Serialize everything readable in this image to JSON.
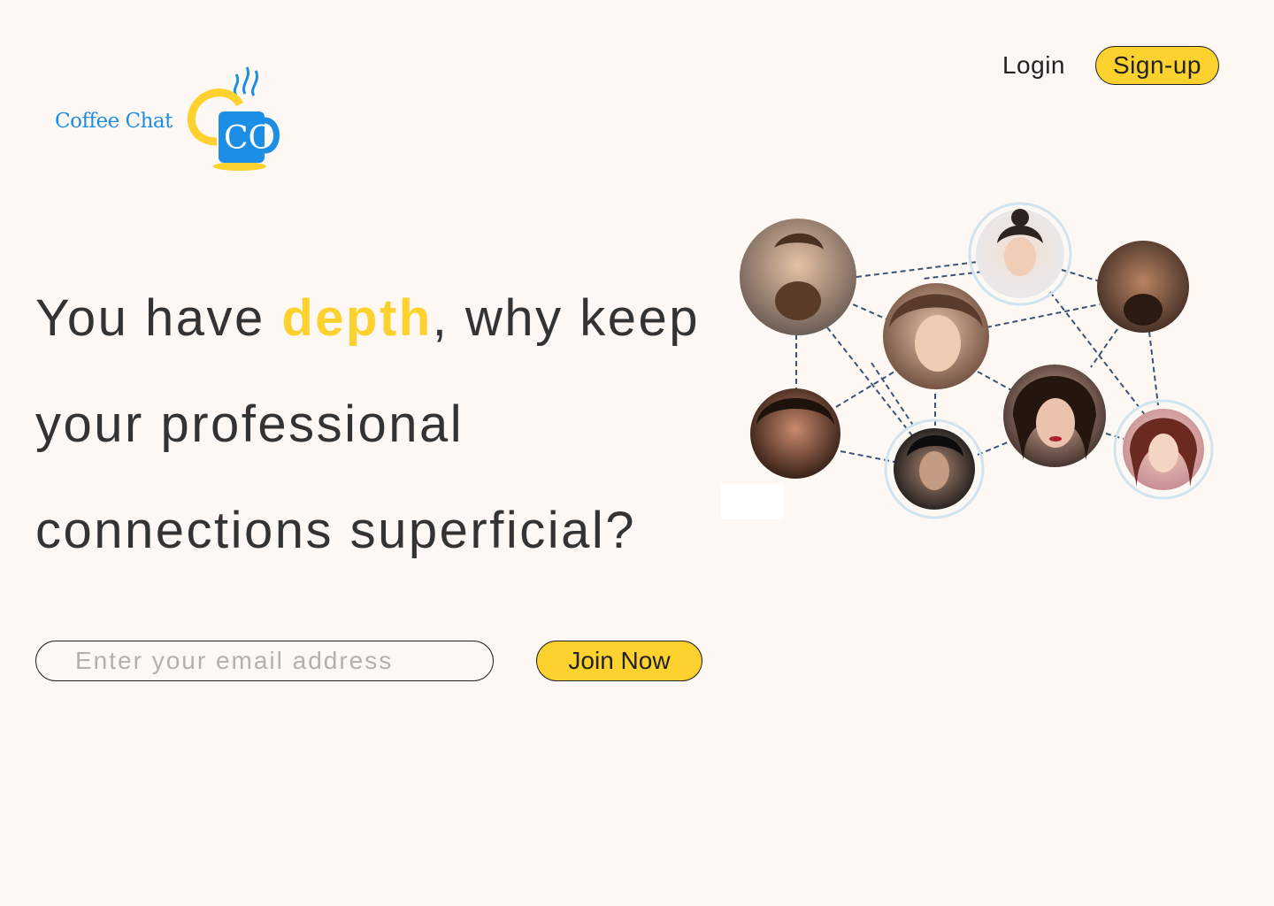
{
  "brand": {
    "name": "Coffee Chat",
    "monogram": "CC",
    "colors": {
      "blue": "#1c8ee6",
      "yellow": "#fdd22e"
    }
  },
  "nav": {
    "login_label": "Login",
    "signup_label": "Sign-up"
  },
  "hero": {
    "line1_pre": "You have ",
    "line1_accent": "depth",
    "line1_post": ", why keep",
    "line2": "your professional",
    "line3": "connections superficial?"
  },
  "signup_form": {
    "email_placeholder": "Enter your email address",
    "email_value": "",
    "join_label": "Join Now"
  },
  "network": {
    "avatars": [
      "avatar-man-beard",
      "avatar-woman-bun",
      "avatar-man-dark-beard",
      "avatar-woman-freckles",
      "avatar-woman-dark-hair",
      "avatar-woman-red-lips",
      "avatar-young-man",
      "avatar-woman-hand-cheek"
    ]
  }
}
